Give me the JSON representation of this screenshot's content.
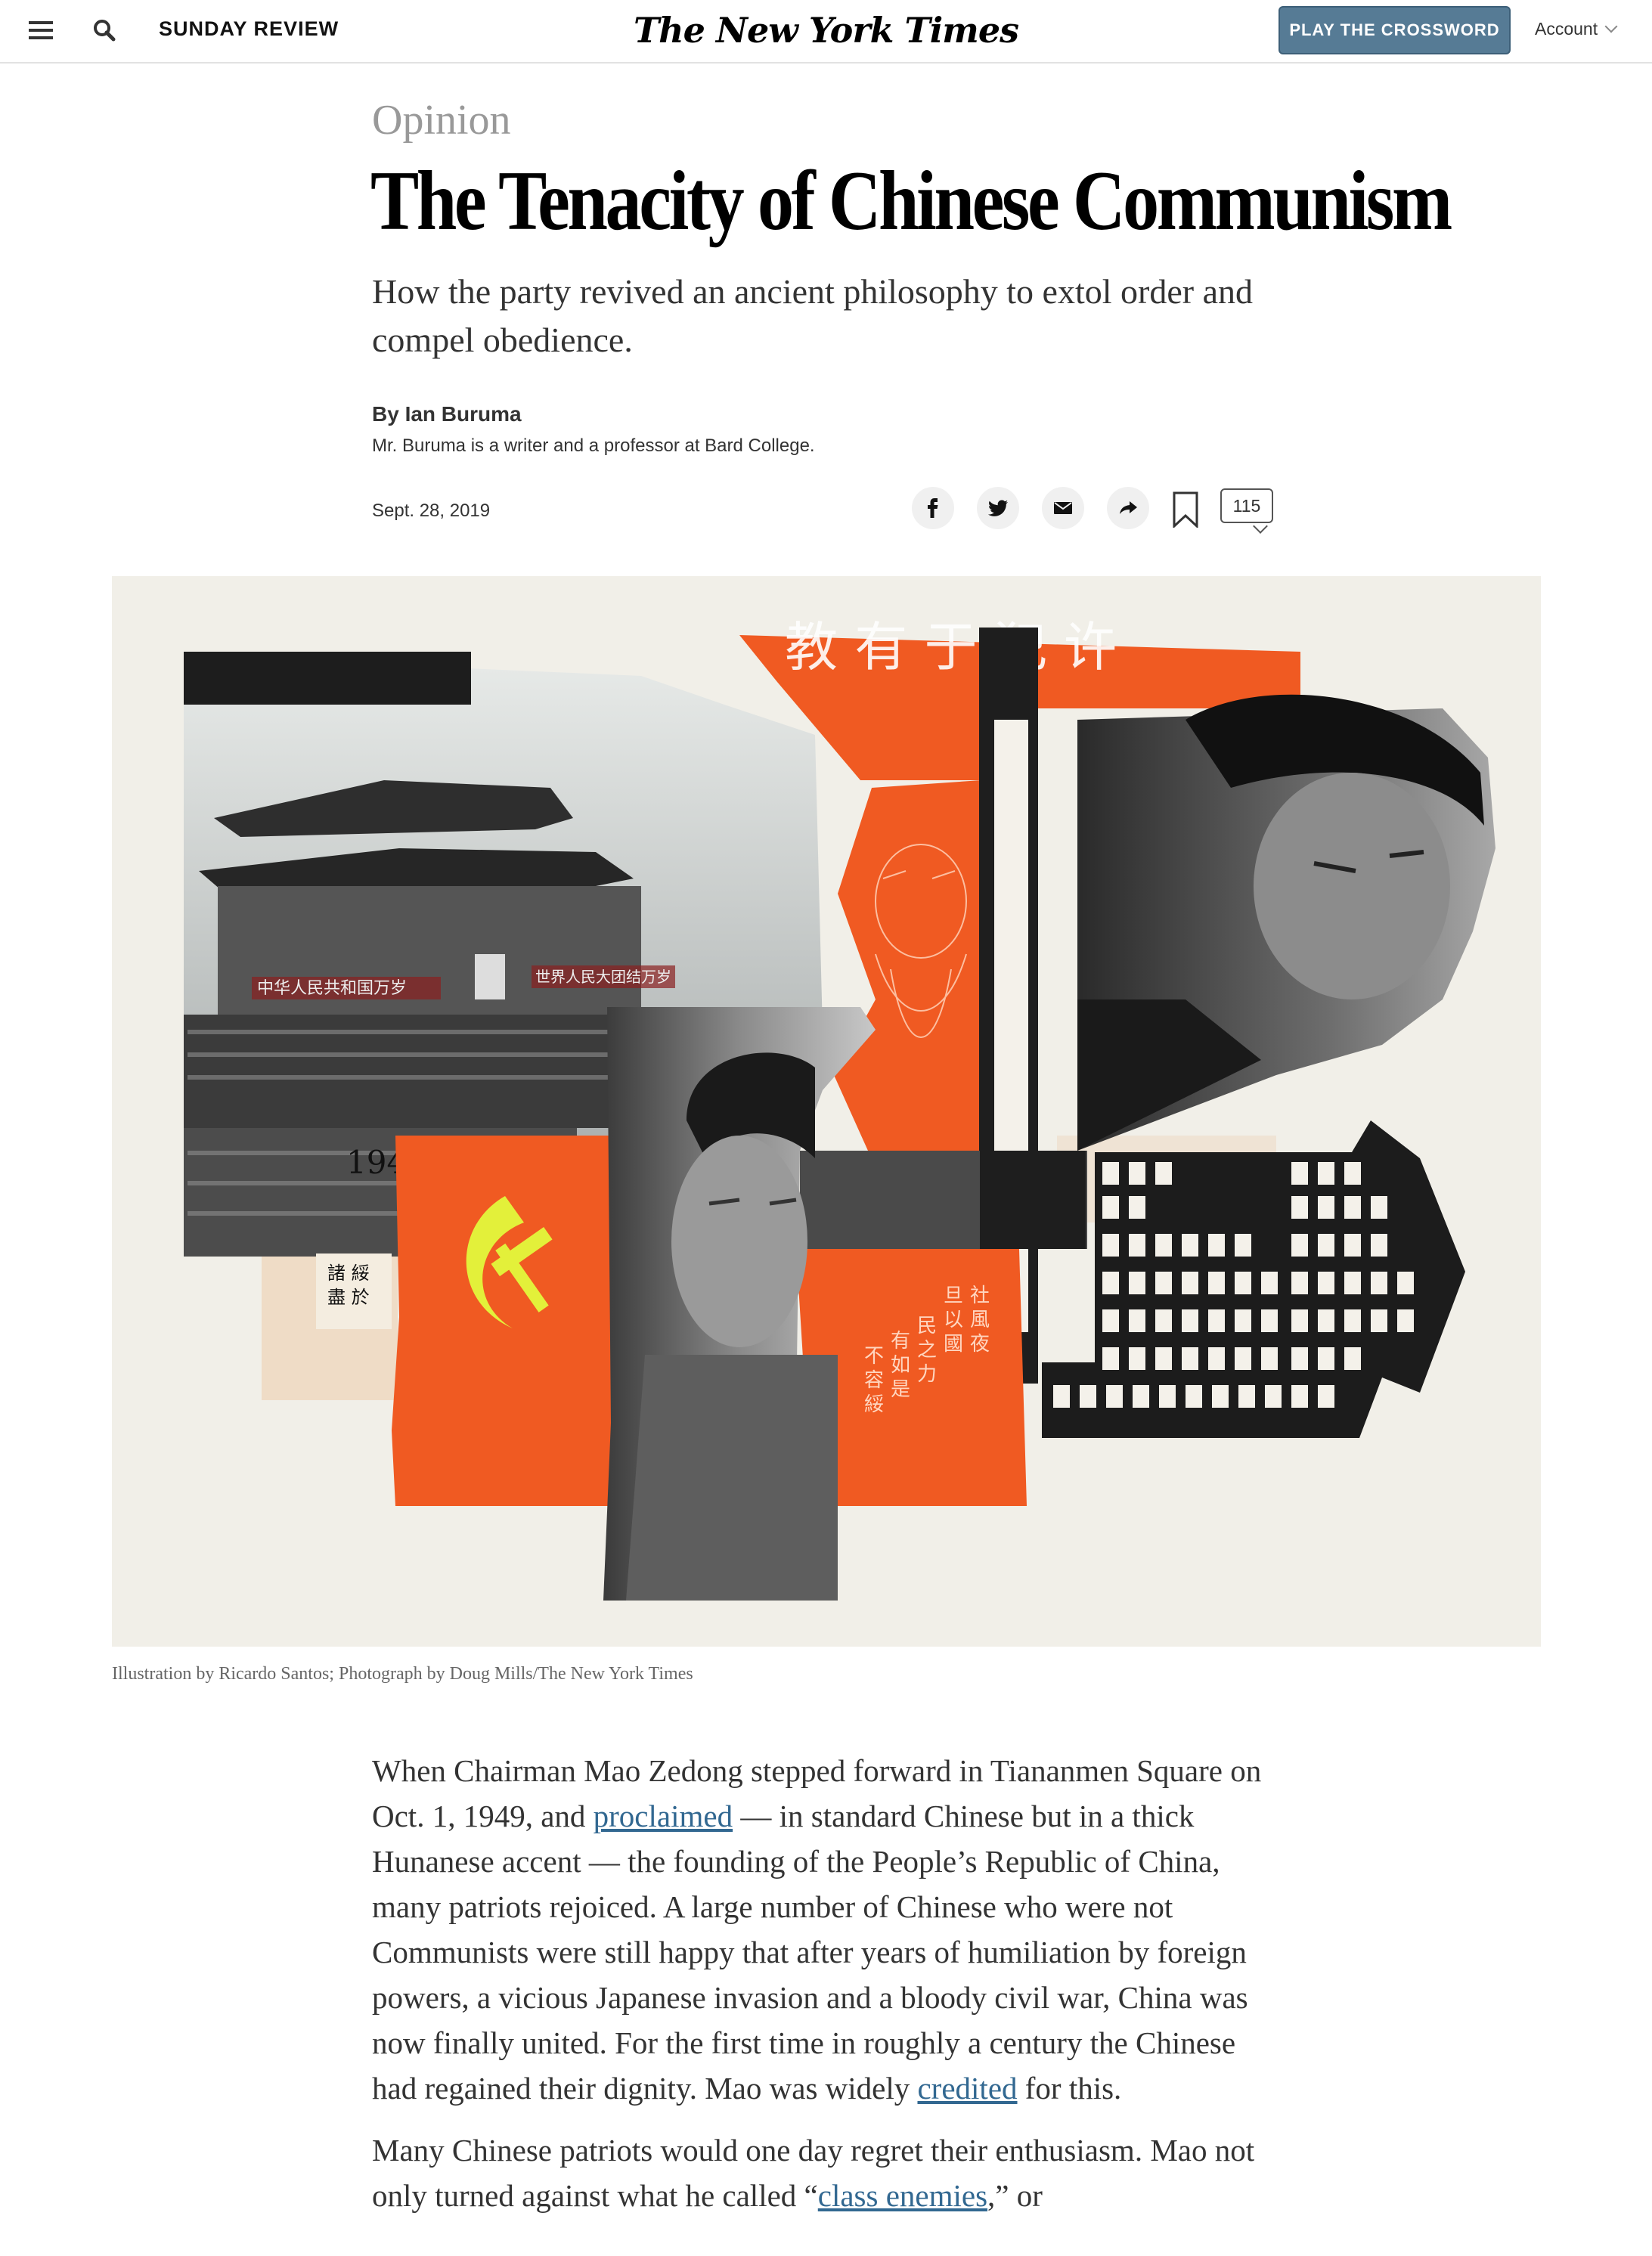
{
  "header": {
    "section": "SUNDAY REVIEW",
    "logo": "The New York Times",
    "crossword_label": "PLAY THE CROSSWORD",
    "account_label": "Account"
  },
  "article": {
    "kicker": "Opinion",
    "headline": "The Tenacity of Chinese Communism",
    "summary": "How the party revived an ancient philosophy to extol order and compel obedience.",
    "byline": "By Ian Buruma",
    "bio": "Mr. Buruma is a writer and a professor at Bard College.",
    "date": "Sept. 28, 2019",
    "comment_count": "115",
    "figure_banner_left": "中华人民共和国万岁",
    "figure_banner_right": "世界人民大团结万岁",
    "figure_year": "1949",
    "caption": "Illustration by Ricardo Santos; Photograph by Doug Mills/The New York Times"
  },
  "body": {
    "p1": {
      "t1": "When Chairman Mao Zedong stepped forward in Tiananmen Square on Oct. 1, 1949, and ",
      "link1": "proclaimed",
      "t2": " — in standard Chinese but in a thick Hunanese accent — the founding of the People’s Republic of China, many patriots rejoiced. A large number of Chinese who were not Communists were still happy that after years of humiliation by foreign powers, a vicious Japanese invasion and a bloody civil war, China was now finally united. For the first time in roughly a century the Chinese had regained their dignity. Mao was widely ",
      "link2": "credited",
      "t3": " for this."
    },
    "p2": {
      "t1": "Many Chinese patriots would one day regret their enthusiasm. Mao not only turned against what he called “",
      "link1": "class enemies",
      "t2": ",” or"
    }
  },
  "colors": {
    "crossword_button": "#567b95",
    "link": "#326891",
    "accent_orange": "#f05a22",
    "hammer_sickle": "#e3f03a"
  }
}
